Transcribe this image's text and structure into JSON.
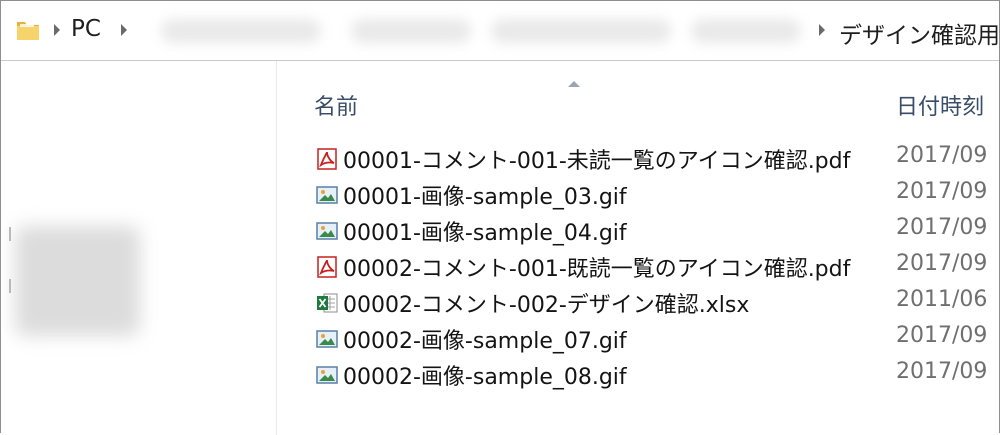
{
  "address_bar": {
    "root_label": "PC",
    "current_folder": "デザイン確認用",
    "icons": [
      "folder-icon",
      "breadcrumb-separator-icon"
    ]
  },
  "columns": {
    "name": "名前",
    "date": "日付時刻",
    "sorted_by": "name",
    "sort_direction": "ascending"
  },
  "files": [
    {
      "name": "00001-コメント-001-未読一覧のアイコン確認.pdf",
      "date": "2017/09",
      "icon": "pdf-file-icon"
    },
    {
      "name": "00001-画像-sample_03.gif",
      "date": "2017/09",
      "icon": "image-file-icon"
    },
    {
      "name": "00001-画像-sample_04.gif",
      "date": "2017/09",
      "icon": "image-file-icon"
    },
    {
      "name": "00002-コメント-001-既読一覧のアイコン確認.pdf",
      "date": "2017/09",
      "icon": "pdf-file-icon"
    },
    {
      "name": "00002-コメント-002-デザイン確認.xlsx",
      "date": "2011/06",
      "icon": "excel-file-icon"
    },
    {
      "name": "00002-画像-sample_07.gif",
      "date": "2017/09",
      "icon": "image-file-icon"
    },
    {
      "name": "00002-画像-sample_08.gif",
      "date": "2017/09",
      "icon": "image-file-icon"
    }
  ],
  "colors": {
    "pdf_red": "#c8201e",
    "excel_green": "#1f7a3e",
    "header_text": "#3a4d68",
    "date_text": "#6f6f6f"
  }
}
